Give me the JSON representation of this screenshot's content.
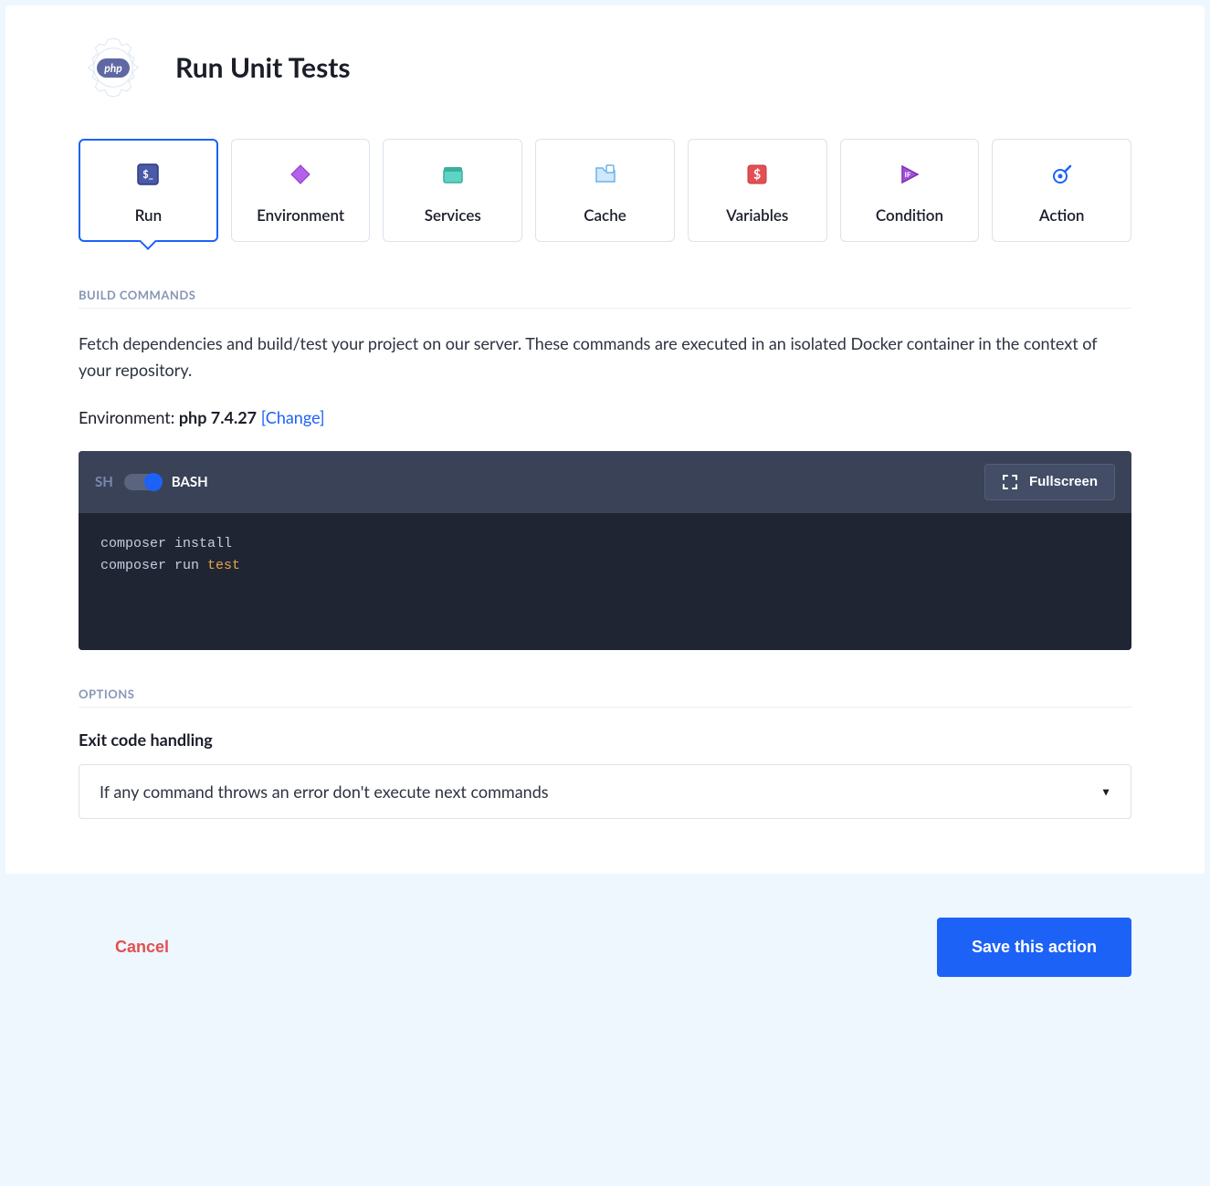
{
  "header": {
    "badge": "php",
    "title": "Run Unit Tests"
  },
  "tabs": [
    {
      "key": "run",
      "label": "Run",
      "active": true
    },
    {
      "key": "environment",
      "label": "Environment",
      "active": false
    },
    {
      "key": "services",
      "label": "Services",
      "active": false
    },
    {
      "key": "cache",
      "label": "Cache",
      "active": false
    },
    {
      "key": "variables",
      "label": "Variables",
      "active": false
    },
    {
      "key": "condition",
      "label": "Condition",
      "active": false
    },
    {
      "key": "action",
      "label": "Action",
      "active": false
    }
  ],
  "build": {
    "heading": "BUILD COMMANDS",
    "description": "Fetch dependencies and build/test your project on our server. These commands are executed in an isolated Docker container in the context of your repository.",
    "env_label": "Environment: ",
    "env_value": "php 7.4.27",
    "change_text": "[Change]",
    "shell_sh": "SH",
    "shell_bash": "BASH",
    "fullscreen": "Fullscreen",
    "code_lines": [
      {
        "text": "composer install"
      },
      {
        "prefix": "composer run ",
        "keyword": "test"
      }
    ]
  },
  "options": {
    "heading": "OPTIONS",
    "exit_label": "Exit code handling",
    "exit_value": "If any command throws an error don't execute next commands"
  },
  "footer": {
    "cancel": "Cancel",
    "save": "Save this action"
  }
}
